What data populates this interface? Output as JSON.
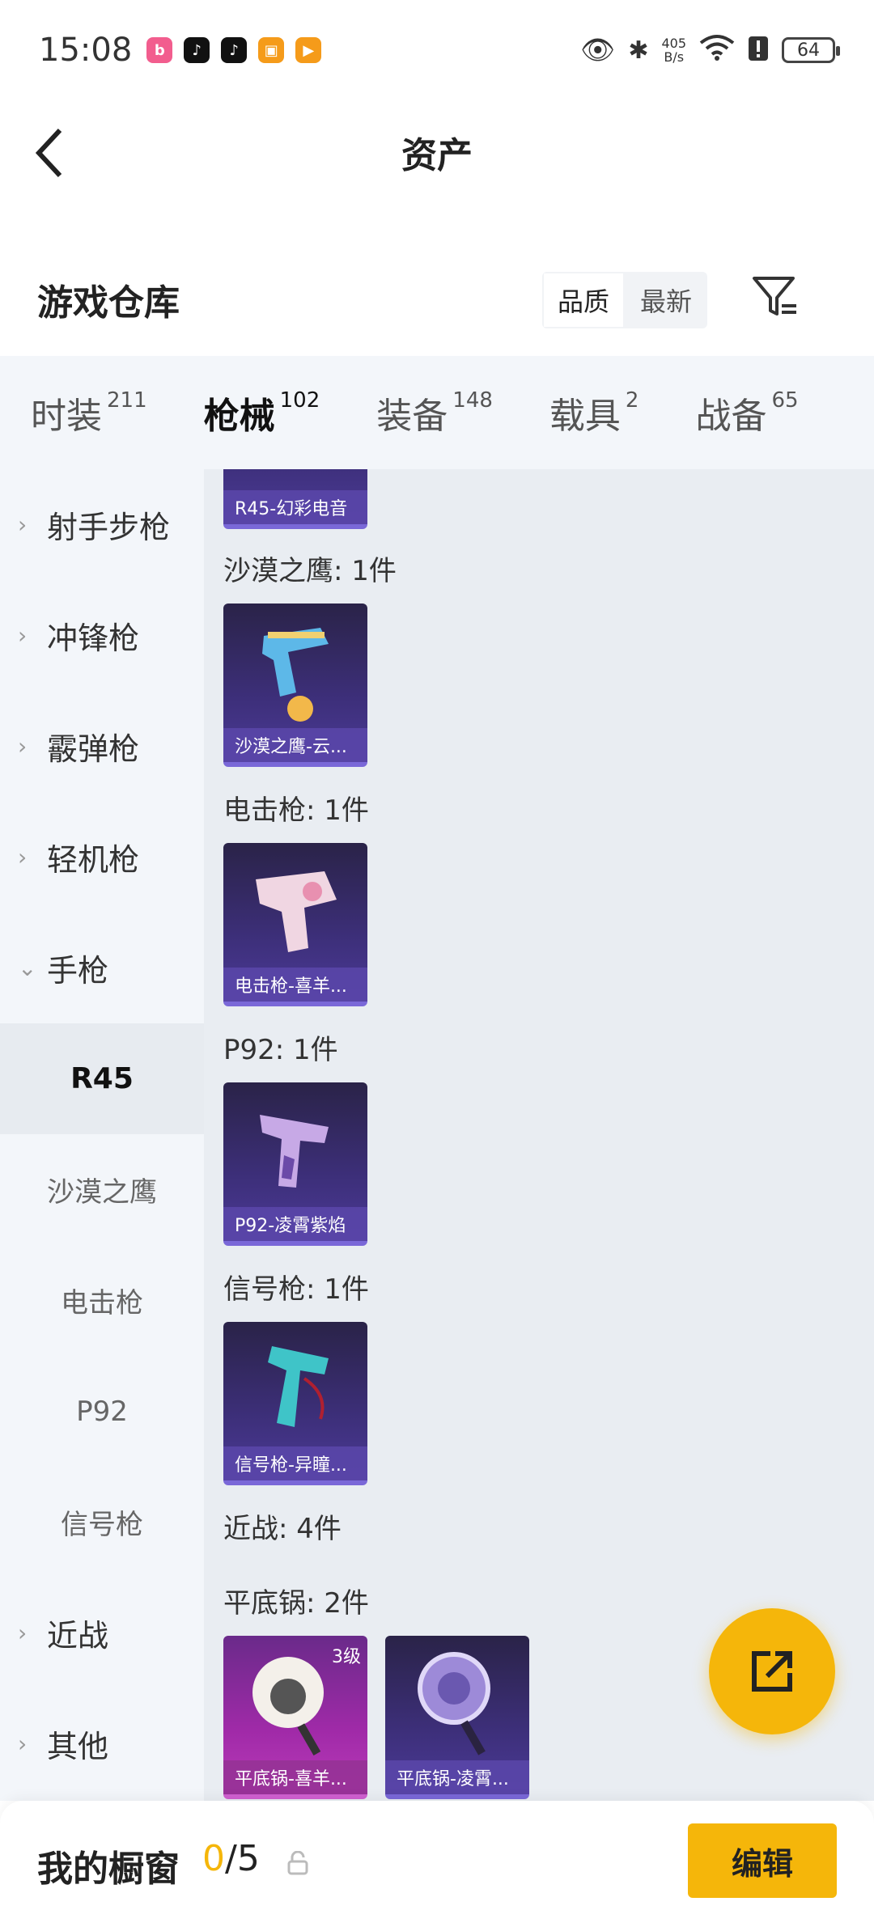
{
  "status_bar": {
    "time": "15:08",
    "net_speed_value": "405",
    "net_speed_unit": "B/s",
    "battery": "64",
    "app_icons": [
      "bilibili-icon",
      "tiktok-icon",
      "tiktok-icon",
      "game-icon",
      "video-icon"
    ]
  },
  "header": {
    "title": "资产"
  },
  "section": {
    "title": "游戏仓库",
    "sort_options": [
      "品质",
      "最新"
    ],
    "active_sort": "品质"
  },
  "tabs": [
    {
      "label": "时装",
      "count": "211"
    },
    {
      "label": "枪械",
      "count": "102",
      "active": true
    },
    {
      "label": "装备",
      "count": "148"
    },
    {
      "label": "载具",
      "count": "2"
    },
    {
      "label": "战备",
      "count": "65"
    }
  ],
  "sidebar": {
    "categories": [
      {
        "label": "射手步枪",
        "chevron": "›"
      },
      {
        "label": "冲锋枪",
        "chevron": "›"
      },
      {
        "label": "霰弹枪",
        "chevron": "›"
      },
      {
        "label": "轻机枪",
        "chevron": "›"
      },
      {
        "label": "手枪",
        "chevron": "⌄"
      }
    ],
    "subitems": [
      "R45",
      "沙漠之鹰",
      "电击枪",
      "P92",
      "信号枪"
    ],
    "active_subitem": "R45",
    "more_categories": [
      {
        "label": "近战",
        "chevron": "›"
      },
      {
        "label": "其他",
        "chevron": "›"
      }
    ]
  },
  "content": {
    "top_card_caption": "R45-幻彩电音",
    "groups": [
      {
        "label": "沙漠之鹰: 1件",
        "card": "沙漠之鹰-云..."
      },
      {
        "label": "电击枪: 1件",
        "card": "电击枪-喜羊..."
      },
      {
        "label": "P92: 1件",
        "card": "P92-凌霄紫焰"
      },
      {
        "label": "信号枪: 1件",
        "card": "信号枪-异瞳..."
      }
    ],
    "melee_label": "近战: 4件",
    "pan_label": "平底锅: 2件",
    "pan_cards": [
      {
        "caption": "平底锅-喜羊...",
        "level": "3级"
      },
      {
        "caption": "平底锅-凌霄..."
      }
    ]
  },
  "bottom_bar": {
    "title": "我的橱窗",
    "current": "0",
    "total": "/5",
    "edit_label": "编辑"
  },
  "colors": {
    "accent": "#f5b60a",
    "card_purple": "#3d2f7a",
    "card_pink": "#a02aa8"
  }
}
